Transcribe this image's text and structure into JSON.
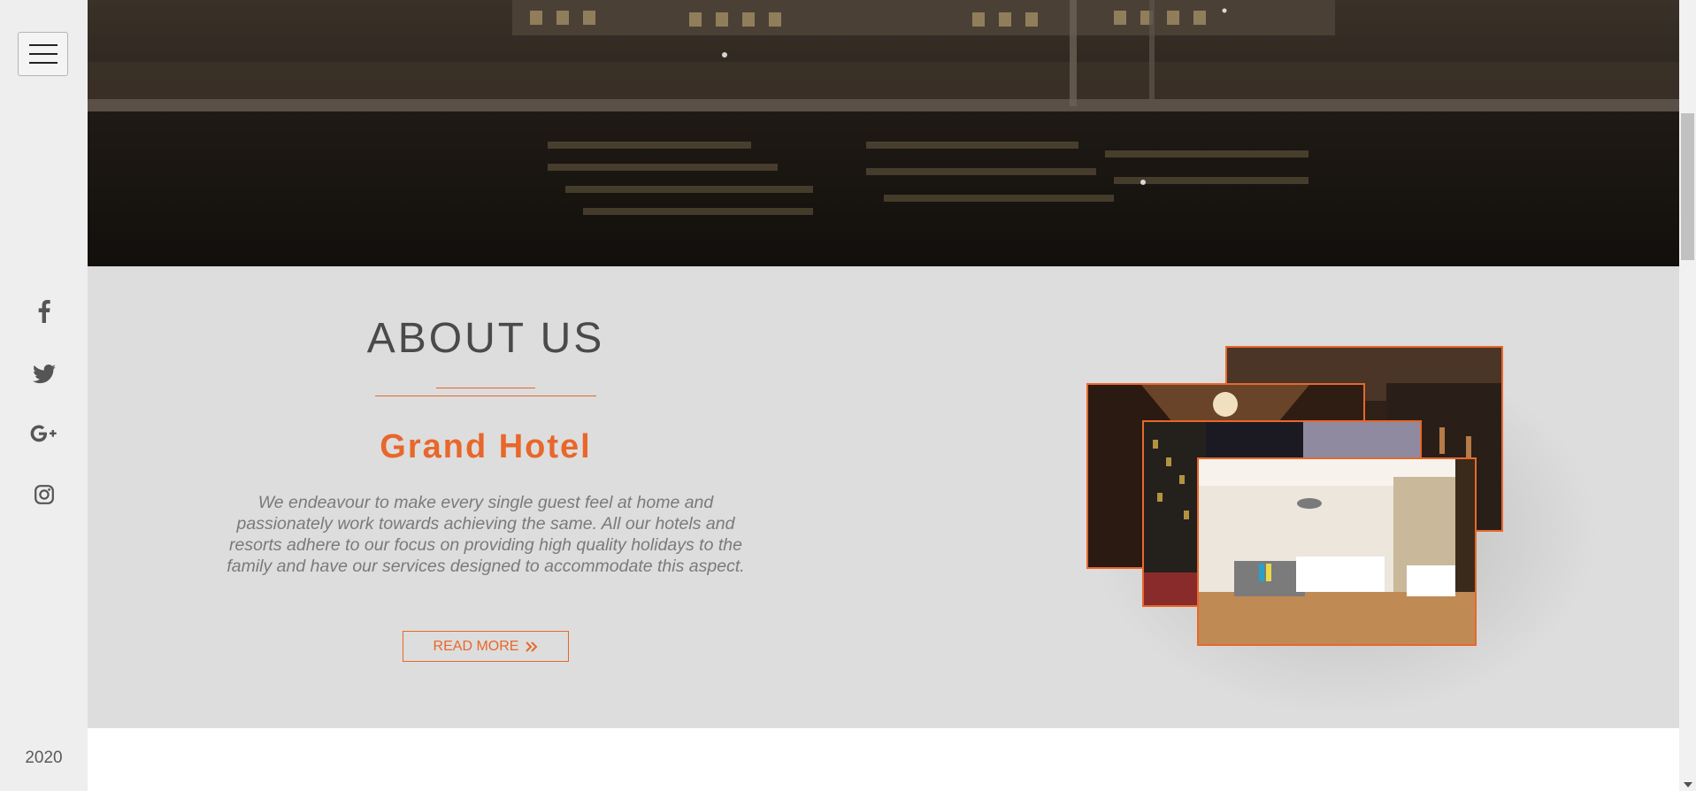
{
  "sidebar": {
    "menu_icon": "hamburger-icon",
    "social_icons": [
      "facebook-icon",
      "twitter-icon",
      "google-plus-icon",
      "instagram-icon"
    ],
    "year": "2020"
  },
  "about": {
    "title": "ABOUT US",
    "hotel_name": "Grand Hotel",
    "description": "We endeavour to make every single guest feel at home and passionately work towards achieving the same. All our hotels and resorts adhere to our focus on providing high quality holidays to the family and have our services designed to accommodate this aspect.",
    "read_more_label": "READ MORE",
    "read_more_icon": "double-chevron-right-icon"
  },
  "colors": {
    "accent": "#e8672b",
    "section_bg": "#dddddd",
    "sidebar_bg": "#eeeeee",
    "title_text": "#4a4a4a",
    "body_text": "#7a7a7a"
  }
}
